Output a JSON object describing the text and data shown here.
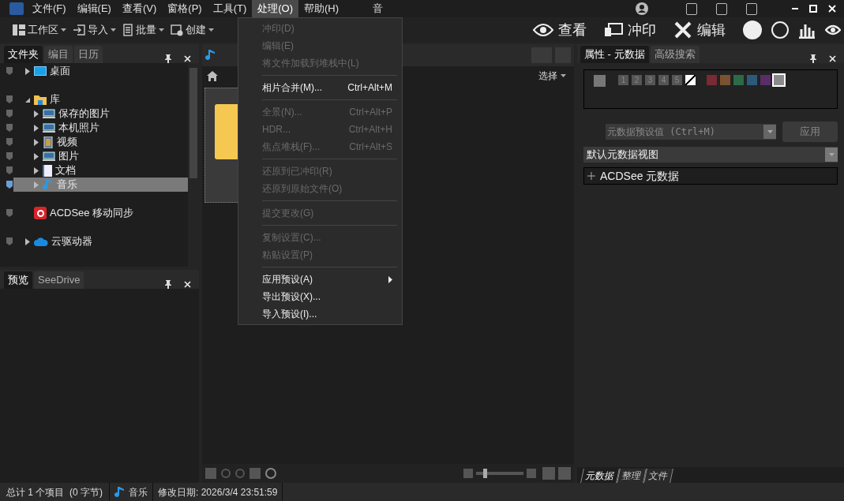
{
  "menubar": {
    "items": [
      {
        "label": "文件(F)",
        "selected": false
      },
      {
        "label": "编辑(E)",
        "selected": false
      },
      {
        "label": "查看(V)",
        "selected": false
      },
      {
        "label": "窗格(P)",
        "selected": false
      },
      {
        "label": "工具(T)",
        "selected": false
      },
      {
        "label": "处理(O)",
        "selected": true
      },
      {
        "label": "帮助(H)",
        "selected": false
      }
    ],
    "extra": "音"
  },
  "toolbar": {
    "buttons": [
      {
        "label": "工作区",
        "kind": "workspace"
      },
      {
        "label": "导入",
        "kind": "import"
      },
      {
        "label": "批量",
        "kind": "batch"
      },
      {
        "label": "创建",
        "kind": "create"
      }
    ],
    "modes": [
      {
        "label": "查看",
        "kind": "view"
      },
      {
        "label": "冲印",
        "kind": "develop"
      },
      {
        "label": "编辑",
        "kind": "edit"
      }
    ]
  },
  "left_panel": {
    "tabs": [
      {
        "label": "文件夹",
        "selected": true
      },
      {
        "label": "编目",
        "selected": false
      },
      {
        "label": "日历",
        "selected": false
      }
    ],
    "tree": [
      {
        "label": "桌面",
        "kind": "desktop",
        "expanded": false,
        "selected": false
      },
      {
        "label": "库",
        "kind": "library",
        "expanded": true,
        "selected": false,
        "children": [
          {
            "label": "保存的图片",
            "kind": "drive",
            "expanded": false,
            "selected": false
          },
          {
            "label": "本机照片",
            "kind": "drive",
            "expanded": false,
            "selected": false
          },
          {
            "label": "视频",
            "kind": "video",
            "expanded": false,
            "selected": false
          },
          {
            "label": "图片",
            "kind": "drive",
            "expanded": false,
            "selected": false
          },
          {
            "label": "文档",
            "kind": "document",
            "expanded": false,
            "selected": false
          },
          {
            "label": "音乐",
            "kind": "music",
            "expanded": false,
            "selected": true
          }
        ]
      },
      {
        "label": "ACDSee 移动同步",
        "kind": "sync",
        "selected": false
      },
      {
        "label": "云驱动器",
        "kind": "cloud",
        "expanded": false,
        "selected": false
      }
    ]
  },
  "preview_panel": {
    "tabs": [
      {
        "label": "预览",
        "selected": true
      },
      {
        "label": "SeeDrive",
        "selected": false
      }
    ]
  },
  "browser": {
    "select_label": "选择",
    "thumbnail_size": {
      "level": 0.15
    }
  },
  "process_menu": [
    {
      "kind": "item",
      "label": "冲印(D)",
      "disabled": true
    },
    {
      "kind": "item",
      "label": "编辑(E)",
      "disabled": true
    },
    {
      "kind": "item",
      "label": "将文件加载到堆栈中(L)",
      "disabled": true
    },
    {
      "kind": "separator"
    },
    {
      "kind": "item",
      "label": "相片合并(M)...",
      "shortcut": "Ctrl+Alt+M",
      "disabled": false
    },
    {
      "kind": "separator"
    },
    {
      "kind": "item",
      "label": "全景(N)...",
      "shortcut": "Ctrl+Alt+P",
      "disabled": true
    },
    {
      "kind": "item",
      "label": "HDR...",
      "shortcut": "Ctrl+Alt+H",
      "disabled": true
    },
    {
      "kind": "item",
      "label": "焦点堆栈(F)...",
      "shortcut": "Ctrl+Alt+S",
      "disabled": true
    },
    {
      "kind": "separator"
    },
    {
      "kind": "item",
      "label": "还原到已冲印(R)",
      "disabled": true
    },
    {
      "kind": "item",
      "label": "还原到原始文件(O)",
      "disabled": true
    },
    {
      "kind": "separator"
    },
    {
      "kind": "item",
      "label": "提交更改(G)",
      "disabled": true
    },
    {
      "kind": "separator"
    },
    {
      "kind": "item",
      "label": "复制设置(C)...",
      "disabled": true
    },
    {
      "kind": "item",
      "label": "粘贴设置(P)",
      "disabled": true
    },
    {
      "kind": "separator"
    },
    {
      "kind": "item",
      "label": "应用预设(A)",
      "disabled": false,
      "submenu": true
    },
    {
      "kind": "item",
      "label": "导出预设(X)...",
      "disabled": false
    },
    {
      "kind": "item",
      "label": "导入预设(I)...",
      "disabled": false
    }
  ],
  "right_panel": {
    "tabs": [
      {
        "label": "属性 - 元数据",
        "selected": true
      },
      {
        "label": "高级搜索",
        "selected": false
      }
    ],
    "ratings": [
      "1",
      "2",
      "3",
      "4",
      "5"
    ],
    "color_labels": [
      {
        "color": "#7a2a32"
      },
      {
        "color": "#7a5230"
      },
      {
        "color": "#2c6a48"
      },
      {
        "color": "#2c5a7a"
      },
      {
        "color": "#5a2c6a"
      },
      {
        "color": "#8a8a8a"
      }
    ],
    "preset": {
      "placeholder": "元数据预设值 (Ctrl+M)"
    },
    "apply_button": "应用",
    "view_select": "默认元数据视图",
    "section": "ACDSee 元数据",
    "bottom_tabs": [
      {
        "label": "元数据",
        "selected": true
      },
      {
        "label": "整理",
        "selected": false
      },
      {
        "label": "文件",
        "selected": false
      }
    ]
  },
  "status_bar": {
    "total": "总计 1 个项目  (0 字节)",
    "folder": "音乐",
    "modified": "修改日期: 2026/3/4 23:51:59"
  }
}
